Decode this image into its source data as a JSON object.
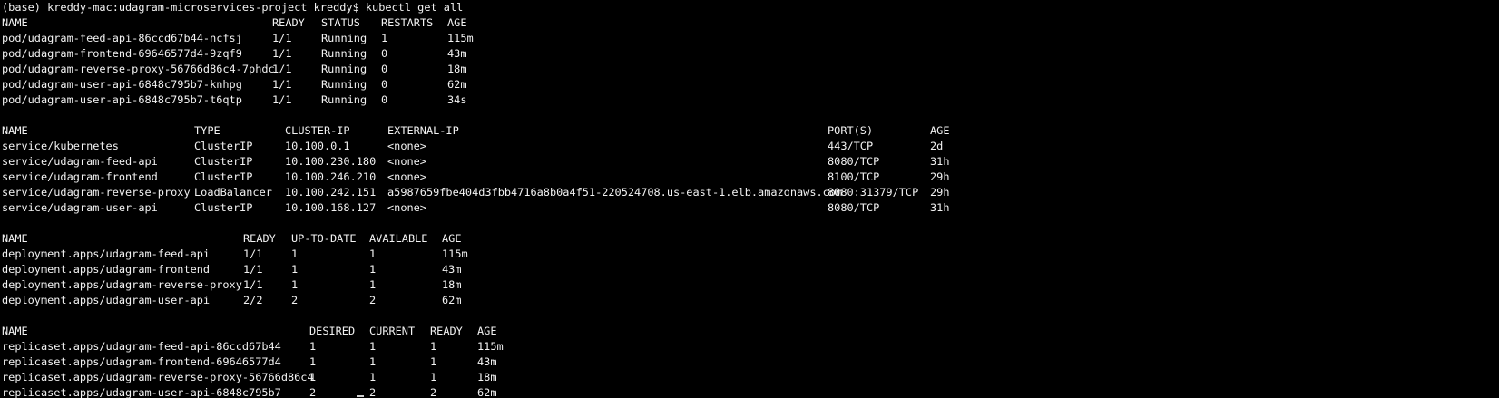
{
  "prompt": {
    "text": "(base) kreddy-mac:udagram-microservices-project kreddy$ kubectl get all"
  },
  "pods": {
    "headers": [
      "NAME",
      "READY",
      "STATUS",
      "RESTARTS",
      "AGE"
    ],
    "rows": [
      [
        "pod/udagram-feed-api-86ccd67b44-ncfsj",
        "1/1",
        "Running",
        "1",
        "115m"
      ],
      [
        "pod/udagram-frontend-69646577d4-9zqf9",
        "1/1",
        "Running",
        "0",
        "43m"
      ],
      [
        "pod/udagram-reverse-proxy-56766d86c4-7phdc",
        "1/1",
        "Running",
        "0",
        "18m"
      ],
      [
        "pod/udagram-user-api-6848c795b7-knhpg",
        "1/1",
        "Running",
        "0",
        "62m"
      ],
      [
        "pod/udagram-user-api-6848c795b7-t6qtp",
        "1/1",
        "Running",
        "0",
        "34s"
      ]
    ]
  },
  "services": {
    "headers": [
      "NAME",
      "TYPE",
      "CLUSTER-IP",
      "EXTERNAL-IP",
      "PORT(S)",
      "AGE"
    ],
    "rows": [
      [
        "service/kubernetes",
        "ClusterIP",
        "10.100.0.1",
        "<none>",
        "443/TCP",
        "2d"
      ],
      [
        "service/udagram-feed-api",
        "ClusterIP",
        "10.100.230.180",
        "<none>",
        "8080/TCP",
        "31h"
      ],
      [
        "service/udagram-frontend",
        "ClusterIP",
        "10.100.246.210",
        "<none>",
        "8100/TCP",
        "29h"
      ],
      [
        "service/udagram-reverse-proxy",
        "LoadBalancer",
        "10.100.242.151",
        "a5987659fbe404d3fbb4716a8b0a4f51-220524708.us-east-1.elb.amazonaws.com",
        "8080:31379/TCP",
        "29h"
      ],
      [
        "service/udagram-user-api",
        "ClusterIP",
        "10.100.168.127",
        "<none>",
        "8080/TCP",
        "31h"
      ]
    ]
  },
  "deployments": {
    "headers": [
      "NAME",
      "READY",
      "UP-TO-DATE",
      "AVAILABLE",
      "AGE"
    ],
    "rows": [
      [
        "deployment.apps/udagram-feed-api",
        "1/1",
        "1",
        "1",
        "115m"
      ],
      [
        "deployment.apps/udagram-frontend",
        "1/1",
        "1",
        "1",
        "43m"
      ],
      [
        "deployment.apps/udagram-reverse-proxy",
        "1/1",
        "1",
        "1",
        "18m"
      ],
      [
        "deployment.apps/udagram-user-api",
        "2/2",
        "2",
        "2",
        "62m"
      ]
    ]
  },
  "replicasets": {
    "headers": [
      "NAME",
      "DESIRED",
      "CURRENT",
      "READY",
      "AGE"
    ],
    "rows": [
      [
        "replicaset.apps/udagram-feed-api-86ccd67b44",
        "1",
        "1",
        "1",
        "115m"
      ],
      [
        "replicaset.apps/udagram-frontend-69646577d4",
        "1",
        "1",
        "1",
        "43m"
      ],
      [
        "replicaset.apps/udagram-reverse-proxy-56766d86c4",
        "1",
        "1",
        "1",
        "18m"
      ],
      [
        "replicaset.apps/udagram-user-api-6848c795b7",
        "2",
        "2",
        "2",
        "62m"
      ]
    ]
  }
}
